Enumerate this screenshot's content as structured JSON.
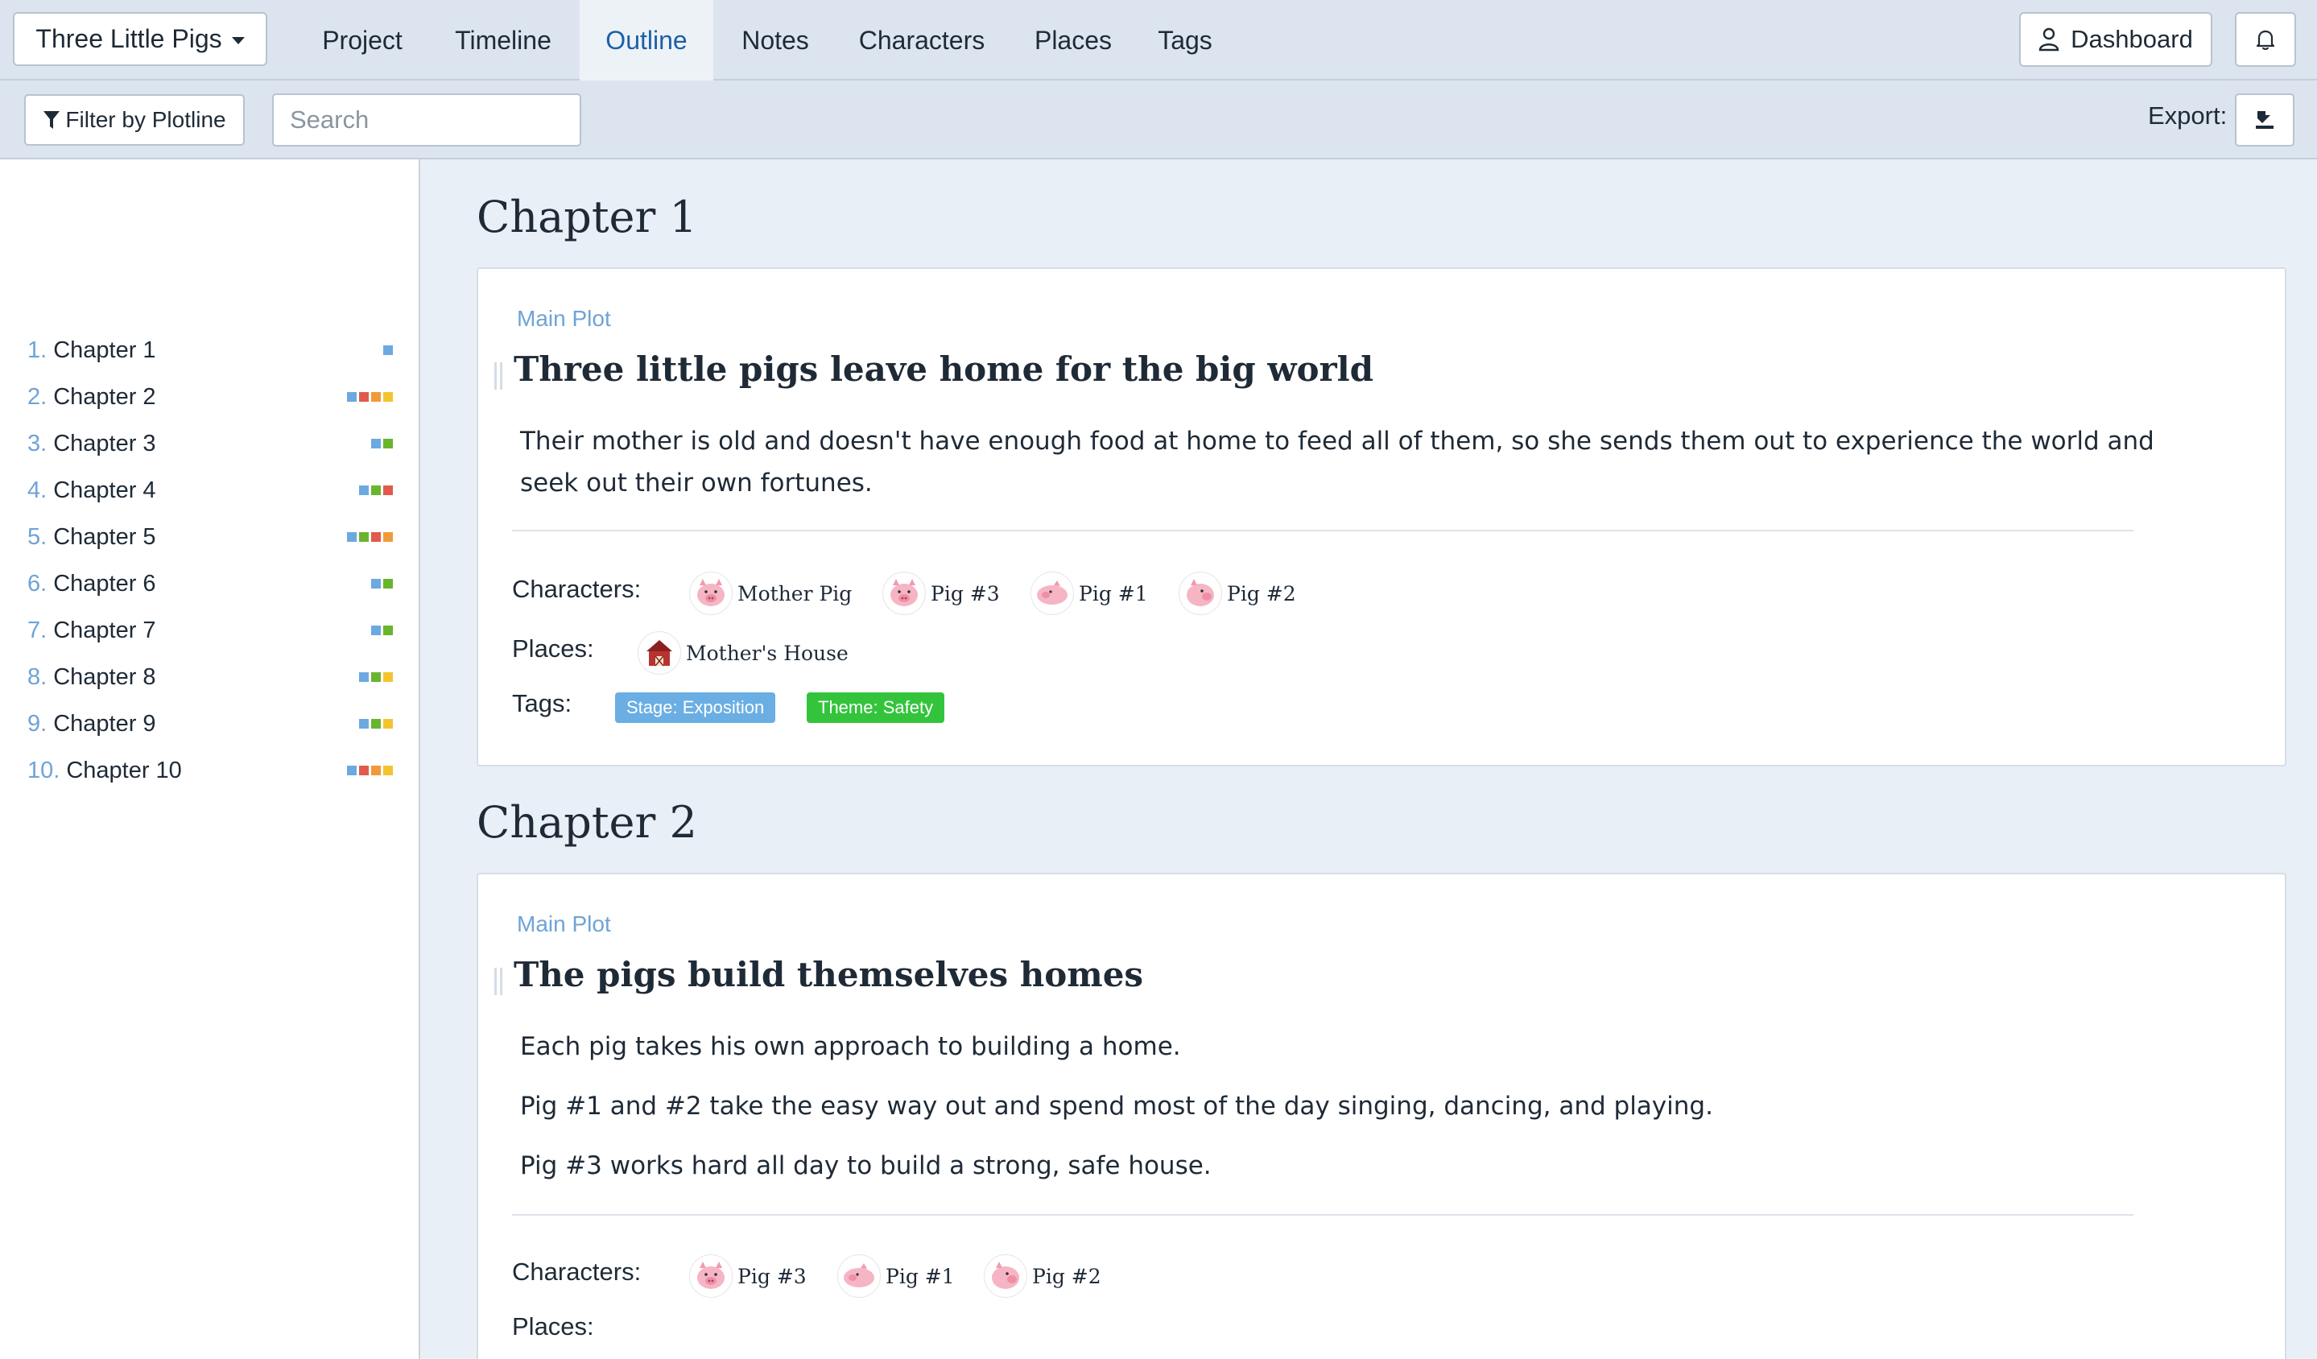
{
  "topnav": {
    "project_name": "Three Little Pigs",
    "tabs": [
      "Project",
      "Timeline",
      "Outline",
      "Notes",
      "Characters",
      "Places",
      "Tags"
    ],
    "active_tab": "Outline",
    "dashboard_label": "Dashboard"
  },
  "subbar": {
    "filter_label": "Filter by Plotline",
    "search_placeholder": "Search",
    "export_label": "Export:"
  },
  "colors": {
    "blue": "#6ca9e0",
    "red": "#e05a4e",
    "orange": "#f29a3a",
    "yellow": "#f4c430",
    "green": "#6ab42e",
    "tag_blue": "#6aaee3",
    "tag_green": "#33c43c",
    "accent": "#1d5fa6"
  },
  "sidebar": {
    "chapters": [
      {
        "num": "1.",
        "label": "Chapter 1",
        "dots": [
          "blue"
        ]
      },
      {
        "num": "2.",
        "label": "Chapter 2",
        "dots": [
          "blue",
          "red",
          "orange",
          "yellow"
        ]
      },
      {
        "num": "3.",
        "label": "Chapter 3",
        "dots": [
          "blue",
          "green"
        ]
      },
      {
        "num": "4.",
        "label": "Chapter 4",
        "dots": [
          "blue",
          "green",
          "red"
        ]
      },
      {
        "num": "5.",
        "label": "Chapter 5",
        "dots": [
          "blue",
          "green",
          "red",
          "orange"
        ]
      },
      {
        "num": "6.",
        "label": "Chapter 6",
        "dots": [
          "blue",
          "green"
        ]
      },
      {
        "num": "7.",
        "label": "Chapter 7",
        "dots": [
          "blue",
          "green"
        ]
      },
      {
        "num": "8.",
        "label": "Chapter 8",
        "dots": [
          "blue",
          "green",
          "yellow"
        ]
      },
      {
        "num": "9.",
        "label": "Chapter 9",
        "dots": [
          "blue",
          "green",
          "yellow"
        ]
      },
      {
        "num": "10.",
        "label": "Chapter 10",
        "dots": [
          "blue",
          "red",
          "orange",
          "yellow"
        ]
      }
    ]
  },
  "main": {
    "chapters": [
      {
        "heading": "Chapter 1",
        "plotline": "Main Plot",
        "title": "Three little pigs leave home for the big world",
        "description": [
          "Their mother is old and doesn't have enough food at home to feed all of them, so she sends them out to experience the world and seek out their own fortunes."
        ],
        "characters_label": "Characters:",
        "characters": [
          "Mother Pig",
          "Pig #3",
          "Pig #1",
          "Pig #2"
        ],
        "places_label": "Places:",
        "places": [
          "Mother's House"
        ],
        "tags_label": "Tags:",
        "tags": [
          "Stage: Exposition",
          "Theme: Safety"
        ]
      },
      {
        "heading": "Chapter 2",
        "plotline": "Main Plot",
        "title": "The pigs build themselves homes",
        "description": [
          "Each pig takes his own approach to building a home.",
          "Pig #1 and #2 take the easy way out and spend most of the day singing, dancing, and playing.",
          "Pig #3 works hard all day to build a strong, safe house."
        ],
        "characters_label": "Characters:",
        "characters": [
          "Pig #3",
          "Pig #1",
          "Pig #2"
        ],
        "places_label": "Places:"
      }
    ]
  }
}
